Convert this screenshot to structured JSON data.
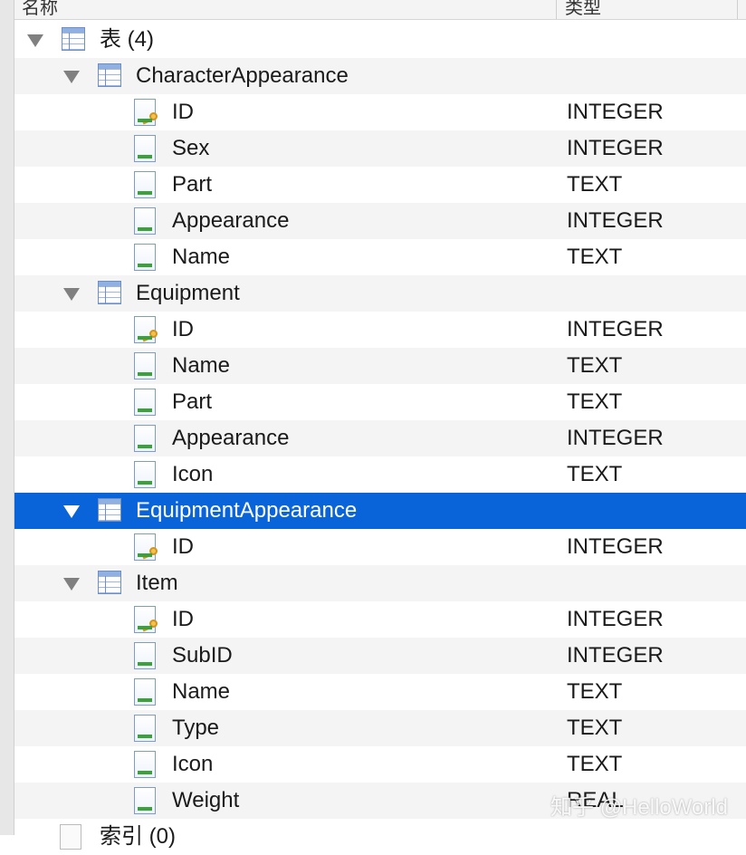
{
  "header": {
    "col_name": "名称",
    "col_type": "类型"
  },
  "root": {
    "label": "表 (4)"
  },
  "tables": [
    {
      "name": "CharacterAppearance",
      "selected": false,
      "columns": [
        {
          "name": "ID",
          "type": "INTEGER",
          "key": true
        },
        {
          "name": "Sex",
          "type": "INTEGER",
          "key": false
        },
        {
          "name": "Part",
          "type": "TEXT",
          "key": false
        },
        {
          "name": "Appearance",
          "type": "INTEGER",
          "key": false
        },
        {
          "name": "Name",
          "type": "TEXT",
          "key": false
        }
      ]
    },
    {
      "name": "Equipment",
      "selected": false,
      "columns": [
        {
          "name": "ID",
          "type": "INTEGER",
          "key": true
        },
        {
          "name": "Name",
          "type": "TEXT",
          "key": false
        },
        {
          "name": "Part",
          "type": "TEXT",
          "key": false
        },
        {
          "name": "Appearance",
          "type": "INTEGER",
          "key": false
        },
        {
          "name": "Icon",
          "type": "TEXT",
          "key": false
        }
      ]
    },
    {
      "name": "EquipmentAppearance",
      "selected": true,
      "columns": [
        {
          "name": "ID",
          "type": "INTEGER",
          "key": true
        }
      ]
    },
    {
      "name": "Item",
      "selected": false,
      "columns": [
        {
          "name": "ID",
          "type": "INTEGER",
          "key": true
        },
        {
          "name": "SubID",
          "type": "INTEGER",
          "key": false
        },
        {
          "name": "Name",
          "type": "TEXT",
          "key": false
        },
        {
          "name": "Type",
          "type": "TEXT",
          "key": false
        },
        {
          "name": "Icon",
          "type": "TEXT",
          "key": false
        },
        {
          "name": "Weight",
          "type": "REAL",
          "key": false
        }
      ]
    }
  ],
  "bottom_partial": {
    "label": "索引 (0)"
  },
  "watermark": "知乎 @HelloWorld",
  "colors": {
    "selection": "#0a64d9",
    "alt_row": "#f4f4f4"
  }
}
